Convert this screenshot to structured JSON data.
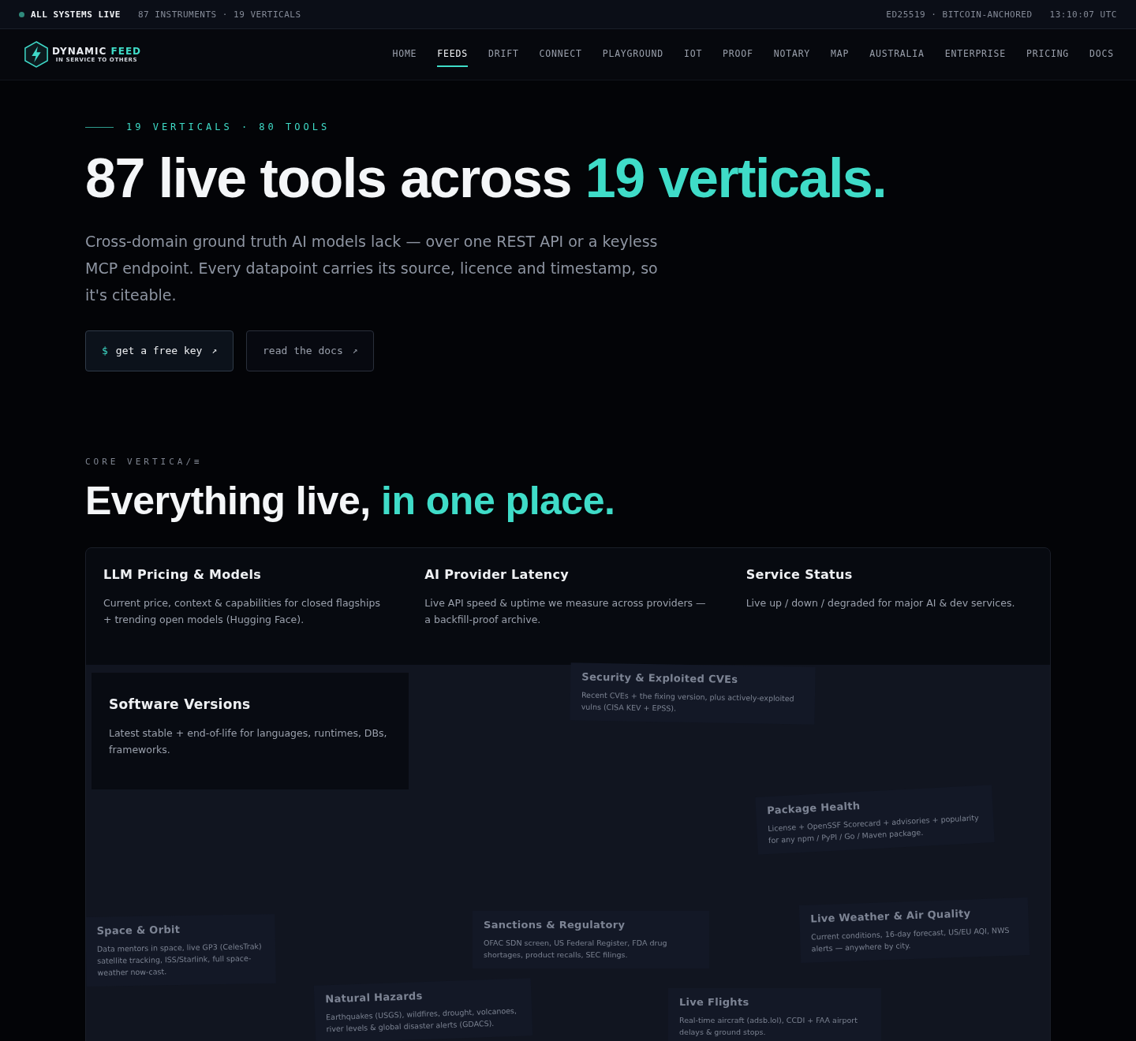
{
  "top_bar": {
    "status": "ALL SYSTEMS LIVE",
    "counts": "87 INSTRUMENTS · 19 VERTICALS",
    "signature": "ED25519 · BITCOIN-ANCHORED",
    "time": "13:10:07 UTC"
  },
  "logo": {
    "name": "DYNAMIC",
    "accent": "FEED",
    "tagline": "IN SERVICE TO OTHERS"
  },
  "nav": [
    {
      "label": "HOME",
      "selected": false
    },
    {
      "label": "FEEDS",
      "selected": true
    },
    {
      "label": "DRIFT",
      "selected": false
    },
    {
      "label": "CONNECT",
      "selected": false
    },
    {
      "label": "PLAYGROUND",
      "selected": false
    },
    {
      "label": "IOT",
      "selected": false
    },
    {
      "label": "PROOF",
      "selected": false
    },
    {
      "label": "NOTARY",
      "selected": false
    },
    {
      "label": "MAP",
      "selected": false
    },
    {
      "label": "AUSTRALIA",
      "selected": false
    },
    {
      "label": "ENTERPRISE",
      "selected": false
    },
    {
      "label": "PRICING",
      "selected": false
    },
    {
      "label": "DOCS",
      "selected": false
    }
  ],
  "hero": {
    "eyebrow": "19 VERTICALS · 80 TOOLS",
    "title": "87 live tools across",
    "title_accent": "19 verticals.",
    "lead": "Cross-domain ground truth AI models lack — over one REST API or a keyless MCP endpoint. Every datapoint carries its source, licence and timestamp, so it's citeable.",
    "buttons": [
      {
        "kind": "primary",
        "prompt": "$",
        "label": "get a free key",
        "icon": "↗"
      },
      {
        "kind": "secondary",
        "label": "read the docs",
        "icon": "↗"
      }
    ]
  },
  "section": {
    "eyebrow": "CORE VERTICA/≡",
    "title": "Everything live,",
    "title_accent": "in one place."
  },
  "cards": [
    {
      "kind": "featured",
      "title": "LLM Pricing & Models",
      "description": "Current price, context & capabilities for closed flagships + trending open models (Hugging Face)."
    },
    {
      "kind": "featured",
      "title": "AI Provider Latency",
      "description": "Live API speed & uptime we measure across providers — a backfill-proof archive."
    },
    {
      "kind": "featured",
      "title": "Service Status",
      "description": "Live up / down / degraded for major AI & dev services."
    },
    {
      "kind": "active",
      "title": "Software Versions",
      "description": "Latest stable + end-of-life for languages, runtimes, DBs, frameworks."
    },
    {
      "kind": "faded",
      "title": "Security & Exploited CVEs",
      "description": "Recent CVEs + the fixing version, plus actively-exploited vulns (CISA KEV + EPSS)."
    },
    {
      "kind": "faded",
      "title": "Package Health",
      "description": "License + OpenSSF Scorecard + advisories + popularity for any npm / PyPI / Go / Maven package."
    },
    {
      "kind": "faded",
      "title": "Space & Orbit",
      "description": "Data mentors in space, live GP3 (CelesTrak) satellite tracking, ISS/Starlink, full space-weather now-cast."
    },
    {
      "kind": "faded",
      "title": "Sanctions & Regulatory",
      "description": "OFAC SDN screen, US Federal Register, FDA drug shortages, product recalls, SEC filings."
    },
    {
      "kind": "faded",
      "title": "Live Weather & Air Quality",
      "description": "Current conditions, 16-day forecast, US/EU AQI, NWS alerts — anywhere by city."
    },
    {
      "kind": "faded",
      "title": "Natural Hazards",
      "description": "Earthquakes (USGS), wildfires, drought, volcanoes, river levels & global disaster alerts (GDACS)."
    },
    {
      "kind": "faded",
      "title": "Live Flights",
      "description": "Real-time aircraft (adsb.lol), CCDI + FAA airport delays & ground stops."
    }
  ]
}
